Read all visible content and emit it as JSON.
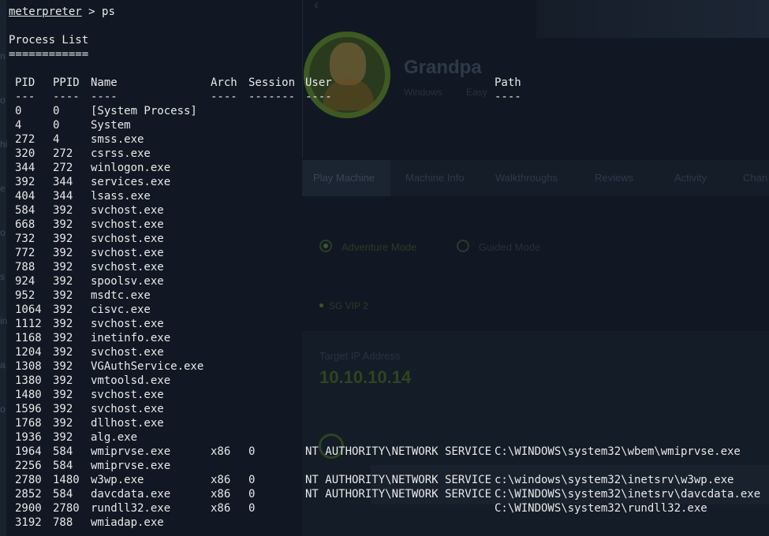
{
  "background": {
    "machine": {
      "name": "Grandpa",
      "os": "Windows",
      "difficulty": "Easy"
    },
    "tabs": [
      "Play Machine",
      "Machine Info",
      "Walkthroughs",
      "Reviews",
      "Activity",
      "Chan"
    ],
    "modes": [
      "Adventure Mode",
      "Guided Mode"
    ],
    "vpn": "SG VIP 2",
    "target_label": "Target IP Address",
    "target_ip": "10.10.10.14",
    "left_fragments": [
      "n",
      "o",
      "hi",
      "e",
      "o",
      "s",
      "in",
      "a",
      "o"
    ]
  },
  "terminal": {
    "prompt": "meterpreter",
    "prompt_symbol": " > ",
    "command": "ps",
    "heading": "Process List",
    "heading_rule": "============",
    "columns": [
      "PID",
      "PPID",
      "Name",
      "Arch",
      "Session",
      "User",
      "Path"
    ],
    "column_rules": [
      "---",
      "----",
      "----",
      "----",
      "-------",
      "----",
      "----"
    ],
    "processes": [
      {
        "pid": "0",
        "ppid": "0",
        "name": "[System Process]",
        "arch": "",
        "session": "",
        "user": "",
        "path": ""
      },
      {
        "pid": "4",
        "ppid": "0",
        "name": "System",
        "arch": "",
        "session": "",
        "user": "",
        "path": ""
      },
      {
        "pid": "272",
        "ppid": "4",
        "name": "smss.exe",
        "arch": "",
        "session": "",
        "user": "",
        "path": ""
      },
      {
        "pid": "320",
        "ppid": "272",
        "name": "csrss.exe",
        "arch": "",
        "session": "",
        "user": "",
        "path": ""
      },
      {
        "pid": "344",
        "ppid": "272",
        "name": "winlogon.exe",
        "arch": "",
        "session": "",
        "user": "",
        "path": ""
      },
      {
        "pid": "392",
        "ppid": "344",
        "name": "services.exe",
        "arch": "",
        "session": "",
        "user": "",
        "path": ""
      },
      {
        "pid": "404",
        "ppid": "344",
        "name": "lsass.exe",
        "arch": "",
        "session": "",
        "user": "",
        "path": ""
      },
      {
        "pid": "584",
        "ppid": "392",
        "name": "svchost.exe",
        "arch": "",
        "session": "",
        "user": "",
        "path": ""
      },
      {
        "pid": "668",
        "ppid": "392",
        "name": "svchost.exe",
        "arch": "",
        "session": "",
        "user": "",
        "path": ""
      },
      {
        "pid": "732",
        "ppid": "392",
        "name": "svchost.exe",
        "arch": "",
        "session": "",
        "user": "",
        "path": ""
      },
      {
        "pid": "772",
        "ppid": "392",
        "name": "svchost.exe",
        "arch": "",
        "session": "",
        "user": "",
        "path": ""
      },
      {
        "pid": "788",
        "ppid": "392",
        "name": "svchost.exe",
        "arch": "",
        "session": "",
        "user": "",
        "path": ""
      },
      {
        "pid": "924",
        "ppid": "392",
        "name": "spoolsv.exe",
        "arch": "",
        "session": "",
        "user": "",
        "path": ""
      },
      {
        "pid": "952",
        "ppid": "392",
        "name": "msdtc.exe",
        "arch": "",
        "session": "",
        "user": "",
        "path": ""
      },
      {
        "pid": "1064",
        "ppid": "392",
        "name": "cisvc.exe",
        "arch": "",
        "session": "",
        "user": "",
        "path": ""
      },
      {
        "pid": "1112",
        "ppid": "392",
        "name": "svchost.exe",
        "arch": "",
        "session": "",
        "user": "",
        "path": ""
      },
      {
        "pid": "1168",
        "ppid": "392",
        "name": "inetinfo.exe",
        "arch": "",
        "session": "",
        "user": "",
        "path": ""
      },
      {
        "pid": "1204",
        "ppid": "392",
        "name": "svchost.exe",
        "arch": "",
        "session": "",
        "user": "",
        "path": ""
      },
      {
        "pid": "1308",
        "ppid": "392",
        "name": "VGAuthService.exe",
        "arch": "",
        "session": "",
        "user": "",
        "path": ""
      },
      {
        "pid": "1380",
        "ppid": "392",
        "name": "vmtoolsd.exe",
        "arch": "",
        "session": "",
        "user": "",
        "path": ""
      },
      {
        "pid": "1480",
        "ppid": "392",
        "name": "svchost.exe",
        "arch": "",
        "session": "",
        "user": "",
        "path": ""
      },
      {
        "pid": "1596",
        "ppid": "392",
        "name": "svchost.exe",
        "arch": "",
        "session": "",
        "user": "",
        "path": ""
      },
      {
        "pid": "1768",
        "ppid": "392",
        "name": "dllhost.exe",
        "arch": "",
        "session": "",
        "user": "",
        "path": ""
      },
      {
        "pid": "1936",
        "ppid": "392",
        "name": "alg.exe",
        "arch": "",
        "session": "",
        "user": "",
        "path": ""
      },
      {
        "pid": "1964",
        "ppid": "584",
        "name": "wmiprvse.exe",
        "arch": "x86",
        "session": "0",
        "user": "NT AUTHORITY\\NETWORK SERVICE",
        "path": "C:\\WINDOWS\\system32\\wbem\\wmiprvse.exe"
      },
      {
        "pid": "2256",
        "ppid": "584",
        "name": "wmiprvse.exe",
        "arch": "",
        "session": "",
        "user": "",
        "path": ""
      },
      {
        "pid": "2780",
        "ppid": "1480",
        "name": "w3wp.exe",
        "arch": "x86",
        "session": "0",
        "user": "NT AUTHORITY\\NETWORK SERVICE",
        "path": "c:\\windows\\system32\\inetsrv\\w3wp.exe"
      },
      {
        "pid": "2852",
        "ppid": "584",
        "name": "davcdata.exe",
        "arch": "x86",
        "session": "0",
        "user": "NT AUTHORITY\\NETWORK SERVICE",
        "path": "C:\\WINDOWS\\system32\\inetsrv\\davcdata.exe"
      },
      {
        "pid": "2900",
        "ppid": "2780",
        "name": "rundll32.exe",
        "arch": "x86",
        "session": "0",
        "user": "",
        "path": "C:\\WINDOWS\\system32\\rundll32.exe"
      },
      {
        "pid": "3192",
        "ppid": "788",
        "name": "wmiadap.exe",
        "arch": "",
        "session": "",
        "user": "",
        "path": ""
      }
    ]
  },
  "colors": {
    "terminal_text": "#e8e8e8",
    "background": "#111823",
    "accent_green": "#3f5a22"
  }
}
